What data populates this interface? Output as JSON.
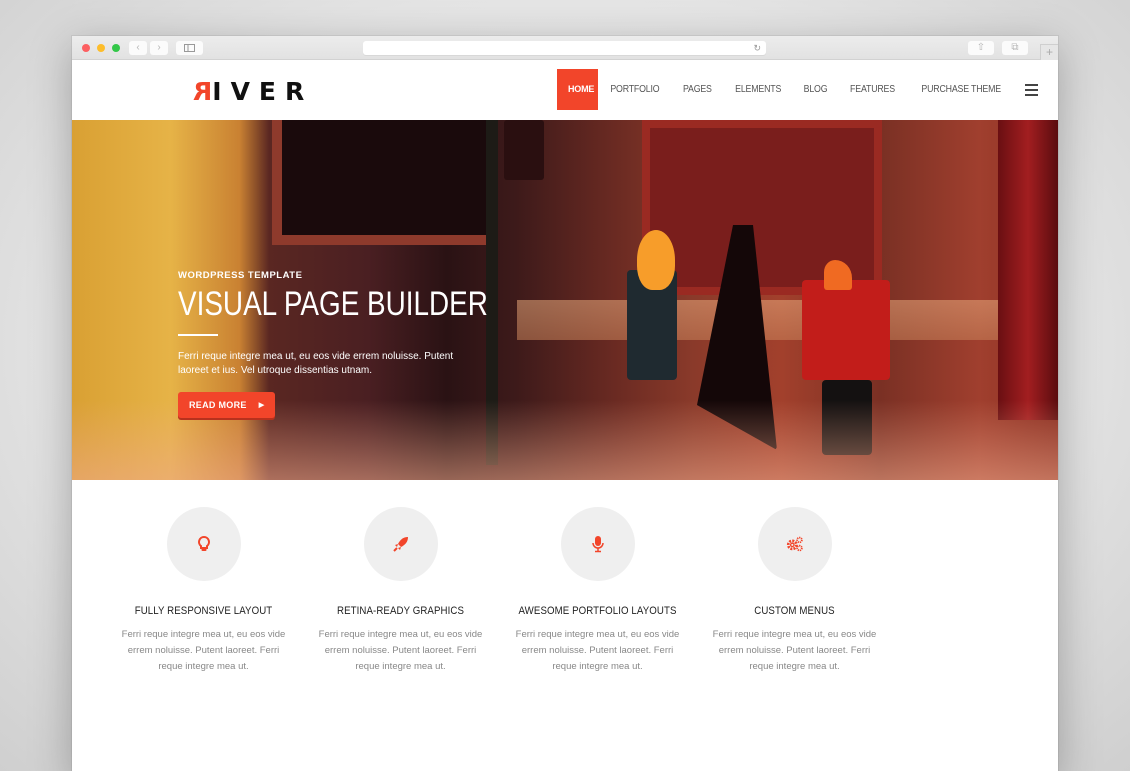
{
  "browser": {
    "controls": [
      "close",
      "minimize",
      "maximize"
    ],
    "back_icon": "‹",
    "forward_icon": "›",
    "reload_icon": "↻",
    "share_icon": "⇧",
    "tabs_icon": "⧉",
    "new_tab_icon": "+"
  },
  "site": {
    "logo_first": "R",
    "logo_rest": "IVER",
    "accent_color": "#f2452a",
    "nav": [
      {
        "label": "HOME",
        "active": true
      },
      {
        "label": "PORTFOLIO",
        "active": false
      },
      {
        "label": "PAGES",
        "active": false
      },
      {
        "label": "ELEMENTS",
        "active": false
      },
      {
        "label": "BLOG",
        "active": false
      },
      {
        "label": "FEATURES",
        "active": false
      },
      {
        "label": "PURCHASE THEME",
        "active": false
      }
    ],
    "menu_icon": "hamburger-icon"
  },
  "hero": {
    "eyebrow": "WORDPRESS TEMPLATE",
    "title": "VISUAL PAGE BUILDER",
    "text": "Ferri reque integre mea ut, eu eos vide errem noluisse. Putent laoreet et ius. Vel utroque dissentias utnam.",
    "button_label": "READ MORE",
    "button_arrow": "▶"
  },
  "features": [
    {
      "icon": "lightbulb-icon",
      "title": "FULLY RESPONSIVE LAYOUT",
      "text": "Ferri reque integre mea ut, eu eos vide errem noluisse. Putent laoreet. Ferri reque integre mea ut."
    },
    {
      "icon": "rocket-icon",
      "title": "RETINA-READY GRAPHICS",
      "text": "Ferri reque integre mea ut, eu eos vide errem noluisse. Putent laoreet. Ferri reque integre mea ut."
    },
    {
      "icon": "microphone-icon",
      "title": "AWESOME PORTFOLIO LAYOUTS",
      "text": "Ferri reque integre mea ut, eu eos vide errem noluisse. Putent laoreet. Ferri reque integre mea ut."
    },
    {
      "icon": "gears-icon",
      "title": "CUSTOM MENUS",
      "text": "Ferri reque integre mea ut, eu eos vide errem noluisse. Putent laoreet. Ferri reque integre mea ut."
    }
  ]
}
